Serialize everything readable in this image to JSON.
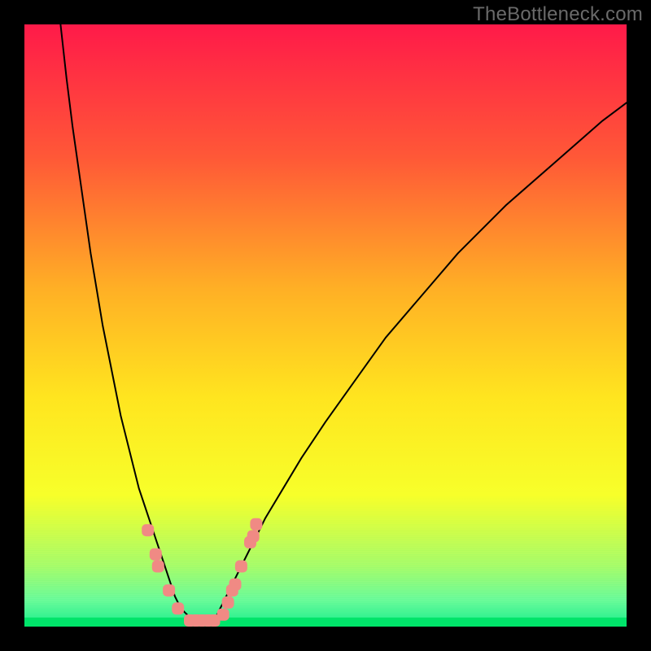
{
  "watermark": "TheBottleneck.com",
  "chart_data": {
    "type": "line",
    "title": "",
    "xlabel": "",
    "ylabel": "",
    "xlim": [
      0,
      100
    ],
    "ylim": [
      0,
      100
    ],
    "grid": false,
    "legend": false,
    "background_gradient": {
      "stops": [
        {
          "offset": 0.0,
          "color": "#ff1a49"
        },
        {
          "offset": 0.22,
          "color": "#ff5837"
        },
        {
          "offset": 0.44,
          "color": "#ffb025"
        },
        {
          "offset": 0.62,
          "color": "#ffe51f"
        },
        {
          "offset": 0.78,
          "color": "#f7ff2a"
        },
        {
          "offset": 0.9,
          "color": "#d2ff6a"
        },
        {
          "offset": 0.955,
          "color": "#8dffb0"
        },
        {
          "offset": 1.0,
          "color": "#00e46a"
        }
      ],
      "banding_note": "very fine horizontal banding near bottom (yellow→green)"
    },
    "series": [
      {
        "name": "bottleneck-curve",
        "color": "#000000",
        "stroke_width": 2,
        "x": [
          6,
          7,
          8,
          9,
          10,
          11,
          12,
          13,
          14,
          15,
          16,
          17,
          18,
          19,
          20,
          21,
          22,
          23,
          24,
          25,
          26,
          27,
          28,
          29,
          30,
          31,
          32,
          33,
          34,
          36,
          38,
          40,
          43,
          46,
          50,
          55,
          60,
          66,
          72,
          80,
          88,
          96,
          100
        ],
        "y": [
          100,
          91,
          83,
          76,
          69,
          62,
          56,
          50,
          45,
          40,
          35,
          31,
          27,
          23,
          20,
          17,
          14,
          11,
          8,
          5,
          3,
          2,
          1,
          0,
          0,
          1,
          2,
          4,
          6,
          10,
          14,
          18,
          23,
          28,
          34,
          41,
          48,
          55,
          62,
          70,
          77,
          84,
          87
        ]
      }
    ],
    "markers": {
      "name": "highlight-dots",
      "color": "#f08a84",
      "shape": "rounded-rect",
      "size": 15,
      "points": [
        {
          "x": 20.5,
          "y": 16
        },
        {
          "x": 21.8,
          "y": 12
        },
        {
          "x": 22.2,
          "y": 10
        },
        {
          "x": 24.0,
          "y": 6
        },
        {
          "x": 25.5,
          "y": 3
        },
        {
          "x": 27.5,
          "y": 1
        },
        {
          "x": 28.5,
          "y": 0
        },
        {
          "x": 29.5,
          "y": 0
        },
        {
          "x": 30.5,
          "y": 0
        },
        {
          "x": 31.5,
          "y": 0
        },
        {
          "x": 33.0,
          "y": 2
        },
        {
          "x": 33.8,
          "y": 4
        },
        {
          "x": 34.5,
          "y": 6
        },
        {
          "x": 35.0,
          "y": 7
        },
        {
          "x": 36.0,
          "y": 10
        },
        {
          "x": 37.5,
          "y": 14
        },
        {
          "x": 38.0,
          "y": 15
        },
        {
          "x": 38.5,
          "y": 17
        }
      ]
    }
  }
}
